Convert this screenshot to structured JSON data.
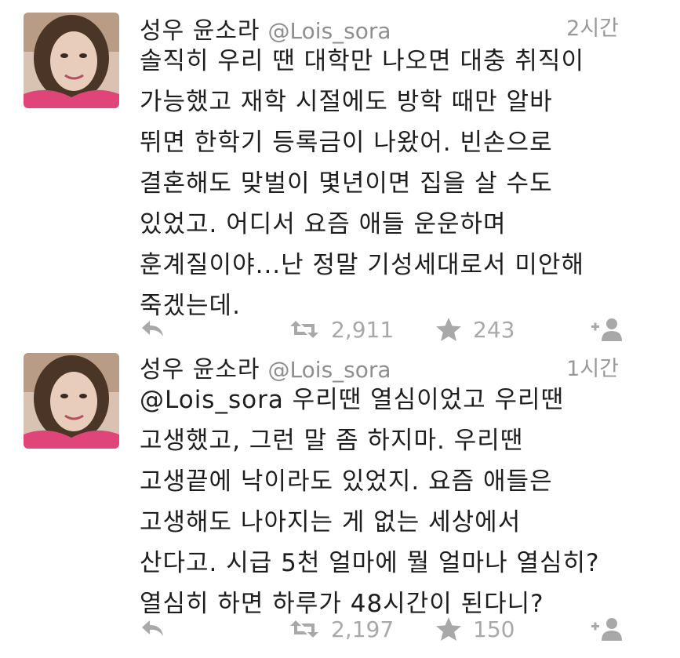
{
  "tweets": [
    {
      "name": "성우 윤소라",
      "handle": "@Lois_sora",
      "time": "2시간",
      "lines": [
        "솔직히 우리 땐 대학만 나오면 대충 취직이",
        "가능했고 재학 시절에도 방학 때만 알바",
        "뛰면 한학기 등록금이 나왔어. 빈손으로",
        "결혼해도 맞벌이 몇년이면 집을 살 수도",
        "있었고. 어디서 요즘 애들 운운하며",
        "훈계질이야...난 정말 기성세대로서 미안해",
        "죽겠는데."
      ],
      "retweets": "2,911",
      "favorites": "243"
    },
    {
      "name": "성우 윤소라",
      "handle": "@Lois_sora",
      "time": "1시간",
      "lines": [
        "@Lois_sora 우리땐 열심이었고 우리땐",
        "고생했고, 그런 말 좀 하지마. 우리땐",
        "고생끝에 낙이라도 있었지. 요즘 애들은",
        "고생해도 나아지는 게 없는 세상에서",
        "산다고. 시급 5천 얼마에 뭘 얼마나 열심히?",
        "열심히 하면 하루가 48시간이 된다니?"
      ],
      "retweets": "2,197",
      "favorites": "150"
    }
  ],
  "icons": {
    "reply": "reply-icon",
    "retweet": "retweet-icon",
    "favorite": "star-icon",
    "follow": "follow-icon",
    "avatar": "profile-photo"
  },
  "colors": {
    "icon_gray": "#a8a8a8",
    "text": "#1e1e1e",
    "handle": "#8e8e8e"
  }
}
